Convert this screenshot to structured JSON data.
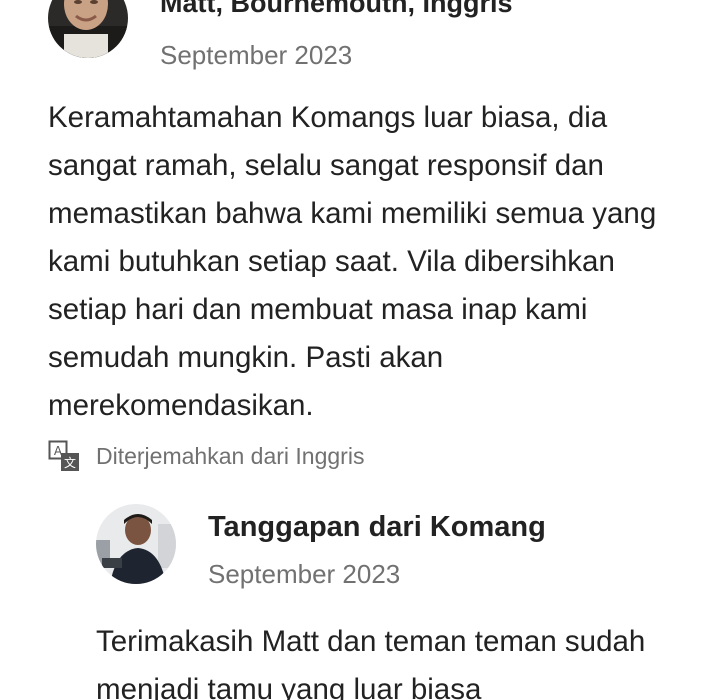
{
  "review": {
    "reviewer_name": "Matt, Bournemouth, Inggris",
    "date": "September 2023",
    "text": "Keramahtamahan Komangs luar biasa, dia sangat ramah, selalu sangat responsif dan memastikan bahwa kami memiliki semua yang kami butuhkan setiap saat. Vila dibersihkan setiap hari dan membuat masa inap kami semudah mungkin. Pasti akan merekomendasikan.",
    "translation_note": "Diterjemahkan dari Inggris"
  },
  "host_response": {
    "title": "Tanggapan dari Komang",
    "date": "September 2023",
    "text": "Terimakasih Matt dan teman teman sudah menjadi tamu yang luar biasa"
  },
  "icons": {
    "translate": "translate-icon"
  },
  "colors": {
    "primary_text": "#222222",
    "secondary_text": "#717171",
    "background": "#ffffff"
  }
}
